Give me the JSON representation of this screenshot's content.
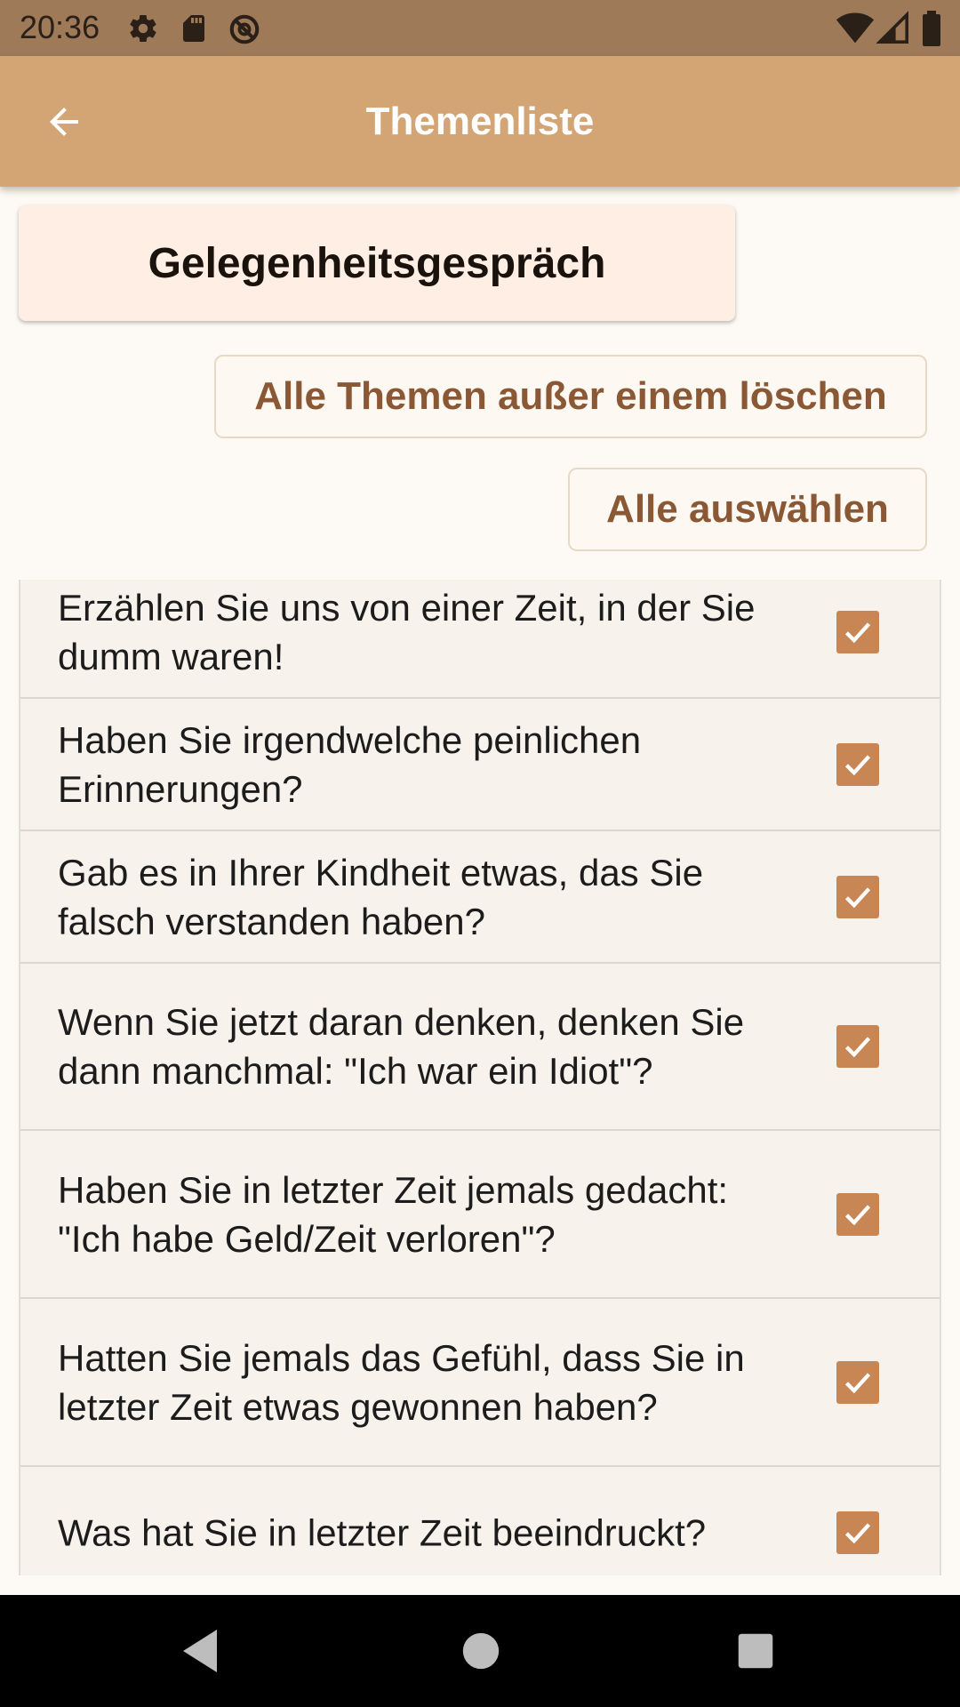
{
  "status_bar": {
    "time": "20:36",
    "left_icons": [
      "gear-icon",
      "sd-card-icon",
      "no-disturb-icon"
    ],
    "right_icons": [
      "wifi-icon",
      "signal-icon",
      "battery-icon"
    ]
  },
  "app_bar": {
    "title": "Themenliste",
    "back_icon": "arrow-left-icon"
  },
  "category": {
    "label": "Gelegenheitsgespräch"
  },
  "actions": {
    "delete_all_but_one": "Alle Themen außer einem löschen",
    "select_all": "Alle auswählen"
  },
  "topics": [
    {
      "text": "Erzählen Sie uns von einer Zeit, in der Sie dumm waren!",
      "checked": true
    },
    {
      "text": "Haben Sie irgendwelche peinlichen Erinnerungen?",
      "checked": true
    },
    {
      "text": "Gab es in Ihrer Kindheit etwas, das Sie falsch verstanden haben?",
      "checked": true
    },
    {
      "text": "Wenn Sie jetzt daran denken, denken Sie dann manchmal: \"Ich war ein Idiot\"?",
      "checked": true
    },
    {
      "text": "Haben Sie in letzter Zeit jemals gedacht: \"Ich habe Geld/Zeit verloren\"?",
      "checked": true
    },
    {
      "text": "Hatten Sie jemals das Gefühl, dass Sie in letzter Zeit etwas gewonnen haben?",
      "checked": true
    },
    {
      "text": "Was hat Sie in letzter Zeit beeindruckt?",
      "checked": true
    }
  ],
  "nav_bar": {
    "icons": [
      "back-triangle-icon",
      "home-circle-icon",
      "recents-square-icon"
    ]
  },
  "colors": {
    "status_bar": "#9e7a58",
    "app_bar": "#d3a575",
    "card_bg": "#feeee3",
    "button_text": "#8a5834",
    "checkbox": "#c98655",
    "list_bg": "#f8f2ec"
  }
}
